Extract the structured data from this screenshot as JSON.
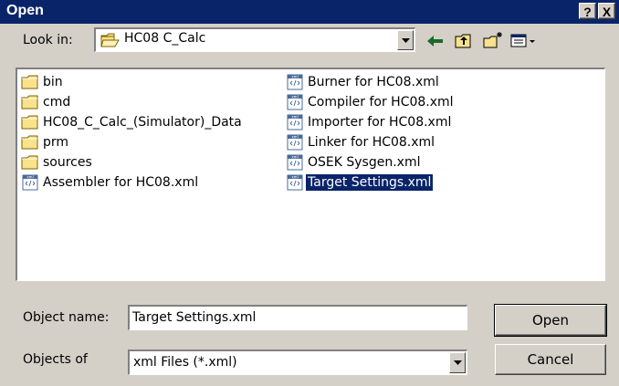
{
  "window": {
    "title": "Open",
    "help_label": "?",
    "close_label": "X"
  },
  "lookin": {
    "label": "Look in:",
    "value": "HC08 C_Calc",
    "icon": "folder-icon"
  },
  "toolbar": {
    "back_icon": "back-arrow-icon",
    "up_icon": "up-folder-icon",
    "new_folder_icon": "new-folder-icon",
    "view_icon": "view-menu-icon"
  },
  "files": {
    "col1": [
      {
        "name": "bin",
        "type": "folder"
      },
      {
        "name": "cmd",
        "type": "folder"
      },
      {
        "name": "HC08_C_Calc_(Simulator)_Data",
        "type": "folder"
      },
      {
        "name": "prm",
        "type": "folder"
      },
      {
        "name": "sources",
        "type": "folder"
      },
      {
        "name": "Assembler for HC08.xml",
        "type": "xml"
      }
    ],
    "col2": [
      {
        "name": "Burner for HC08.xml",
        "type": "xml"
      },
      {
        "name": "Compiler for HC08.xml",
        "type": "xml"
      },
      {
        "name": "Importer for HC08.xml",
        "type": "xml"
      },
      {
        "name": "Linker for HC08.xml",
        "type": "xml"
      },
      {
        "name": "OSEK Sysgen.xml",
        "type": "xml"
      },
      {
        "name": "Target Settings.xml",
        "type": "xml",
        "selected": true
      }
    ]
  },
  "object_name": {
    "label": "Object name:",
    "value": "Target Settings.xml"
  },
  "objects_of": {
    "label": "Objects of",
    "value": "xml Files (*.xml)"
  },
  "buttons": {
    "open": "Open",
    "cancel": "Cancel"
  },
  "colors": {
    "titlebar": "#0a246a",
    "face": "#d4d0c8",
    "selection": "#0a246a",
    "folder": "#f8e38c"
  }
}
